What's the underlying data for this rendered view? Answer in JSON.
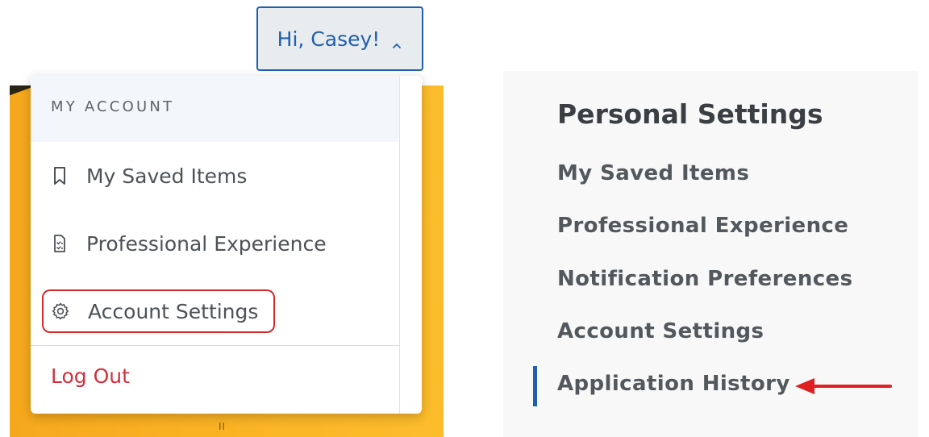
{
  "header": {
    "greeting": "Hi, Casey!"
  },
  "dropdown": {
    "section_label": "MY ACCOUNT",
    "items": [
      {
        "label": "My Saved Items",
        "icon": "bookmark-icon"
      },
      {
        "label": "Professional Experience",
        "icon": "document-checklist-icon"
      },
      {
        "label": "Account Settings",
        "icon": "gear-icon"
      }
    ],
    "logout_label": "Log Out"
  },
  "settings": {
    "title": "Personal Settings",
    "links": [
      {
        "label": "My Saved Items",
        "active": false
      },
      {
        "label": "Professional Experience",
        "active": false
      },
      {
        "label": "Notification Preferences",
        "active": false
      },
      {
        "label": "Account Settings",
        "active": false
      },
      {
        "label": "Application History",
        "active": true
      }
    ]
  },
  "colors": {
    "accent": "#1f5fad",
    "highlight": "#d42a2a",
    "logout": "#d0303c",
    "banner": "#fbb424"
  }
}
